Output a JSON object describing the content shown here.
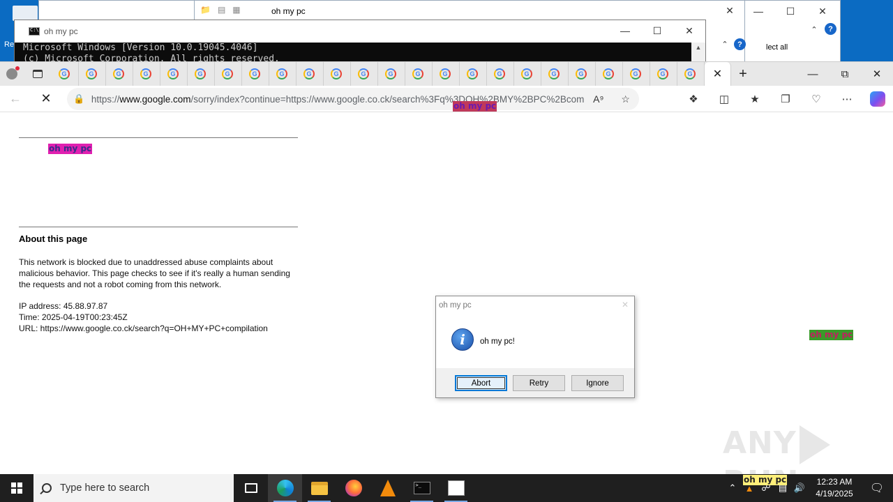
{
  "desktop": {
    "label": "Re"
  },
  "bg_explorer": {
    "title": "oh my pc",
    "select_all": "lect all",
    "help": "?"
  },
  "cmd": {
    "title": "oh my pc",
    "console_line1": "Microsoft Windows [Version 10.0.19045.4046]",
    "console_line2": "(c) Microsoft Corporation. All rights reserved."
  },
  "browser": {
    "tab_count_visible": 24,
    "tab_letter": "G",
    "url_prefix": "https://",
    "url_host": "www.google.com",
    "url_rest": "/sorry/index?continue=https://www.google.co.ck/search%3Fq%3DOH%2BMY%2BPC%2Bcom..."
  },
  "page": {
    "ohpc_label": "oh my pc",
    "about_title": "About this page",
    "about_text": "This network is blocked due to unaddressed abuse complaints about malicious behavior. This page checks to see if it's really a human sending the requests and not a robot coming from this network.",
    "ip_line": "IP address: 45.88.97.87",
    "time_line": "Time: 2025-04-19T00:23:45Z",
    "url_line": "URL: https://www.google.co.ck/search?q=OH+MY+PC+compilation"
  },
  "overlay_labels": [
    {
      "text": "oh my pc",
      "bg": "#c0395a",
      "fg": "#6b1ab0"
    },
    {
      "text": "oh my pc",
      "bg": "#e020b0",
      "fg": "#3a2b8a"
    },
    {
      "text": "oh my pc",
      "bg": "#3a9a2a",
      "fg": "#c02060"
    },
    {
      "text": "oh my pc",
      "bg": "#ffef7a",
      "fg": "#222222"
    }
  ],
  "msgbox": {
    "title": "oh my pc",
    "message": "oh my pc!",
    "buttons": [
      "Abort",
      "Retry",
      "Ignore"
    ]
  },
  "watermark": {
    "left": "ANY",
    "right": "RUN"
  },
  "taskbar": {
    "search_placeholder": "Type here to search",
    "time": "12:23 AM",
    "date": "4/19/2025",
    "icons": [
      "task-view-icon",
      "edge-icon",
      "file-explorer-icon",
      "firefox-icon",
      "vlc-icon",
      "cmd-icon",
      "notepad-icon"
    ]
  }
}
